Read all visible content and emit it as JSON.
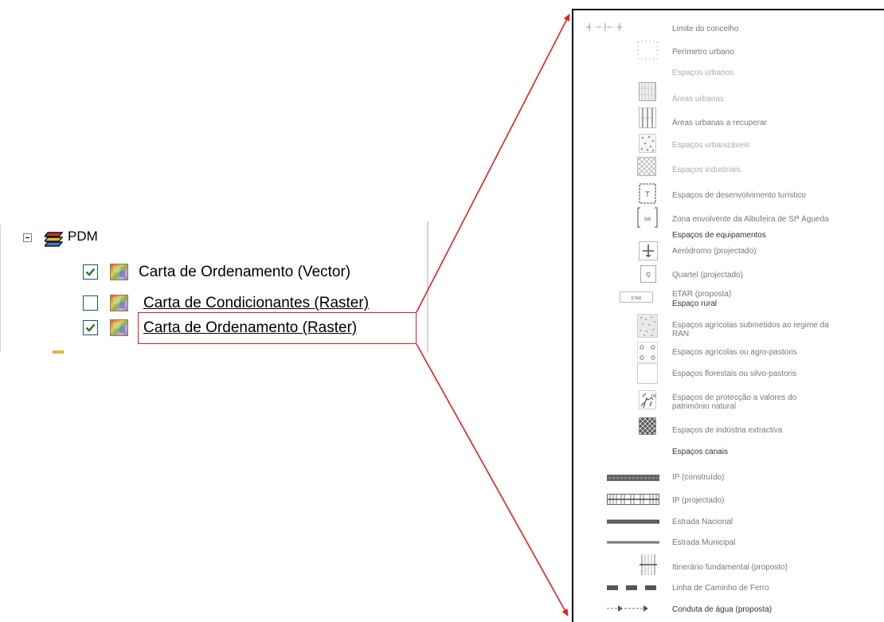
{
  "tree": {
    "group": {
      "label": "PDM",
      "expanded": true
    },
    "layers": [
      {
        "label": "Carta de Ordenamento (Vector)",
        "checked": true,
        "underlined": false
      },
      {
        "label": "Carta de Condicionantes (Raster)",
        "checked": false,
        "underlined": true
      },
      {
        "label": "Carta de Ordenamento (Raster)",
        "checked": true,
        "underlined": true,
        "highlighted": true
      }
    ]
  },
  "legend": {
    "items": [
      {
        "label": "Limite do concelho",
        "symbol": "boundary-dash"
      },
      {
        "label": "Perímetro urbano",
        "symbol": "dotted-rect"
      },
      {
        "label": "Espaços urbanos",
        "symbol": "none",
        "style": "faint"
      },
      {
        "label": "Áreas urbanas",
        "symbol": "vertical-hatch"
      },
      {
        "label": "Áreas urbanas a recuperar",
        "symbol": "vertical-lines"
      },
      {
        "label": "Espaços urbanizáveis",
        "symbol": "dot-pattern"
      },
      {
        "label": "Espaços industriais",
        "symbol": "cross-hatch"
      },
      {
        "label": "Espaços de desenvolvimento turístico",
        "symbol": "t-box",
        "glyph": "T"
      },
      {
        "label": "Zona envolvente da Albufeira de Stª Águeda",
        "symbol": "bracket-box",
        "glyph": "[sa]"
      },
      {
        "label": "Espaços de equipamentos",
        "symbol": "none",
        "style": "dark"
      },
      {
        "label": "Aeródromo (projectado)",
        "symbol": "plane-box"
      },
      {
        "label": "Quartel (projectado)",
        "symbol": "q-box",
        "glyph": "Q"
      },
      {
        "label": "ETAR (proposta)",
        "symbol": "etar-box",
        "glyph": "ETAR"
      },
      {
        "label": "Espaço rural",
        "symbol": "none",
        "style": "dark"
      },
      {
        "label": "Espaços agrícolas submetidos ao regime da RAN",
        "symbol": "stipple"
      },
      {
        "label": "Espaços agrícolas ou agro-pastoris",
        "symbol": "circle-grid"
      },
      {
        "label": "Espaços florestais ou silvo-pastoris",
        "symbol": "empty-box"
      },
      {
        "label": "Espaços de protecção a valores do património natural",
        "symbol": "scribble-box"
      },
      {
        "label": "Espaços de indústria extractiva",
        "symbol": "dense-cross"
      },
      {
        "label": "Espaços canais",
        "symbol": "none",
        "style": "dark"
      },
      {
        "label": "IP (construído)",
        "symbol": "road-thick"
      },
      {
        "label": "IP (projectado)",
        "symbol": "road-hatched"
      },
      {
        "label": "Estrada Nacional",
        "symbol": "road-medium"
      },
      {
        "label": "Estrada Municipal",
        "symbol": "road-thin"
      },
      {
        "label": "Itinerário fundamental (proposto)",
        "symbol": "road-ladder"
      },
      {
        "label": "Linha de Caminho de Ferro",
        "symbol": "rail-dash"
      },
      {
        "label": "Conduta de água (proposta)",
        "symbol": "arrow-dash"
      }
    ]
  },
  "colors": {
    "highlight": "#e31f1f",
    "checkmark": "#1f7a2e",
    "legendText": "#777777"
  }
}
